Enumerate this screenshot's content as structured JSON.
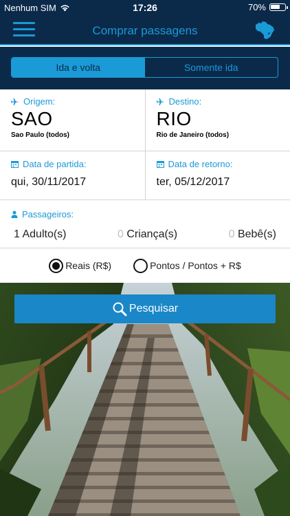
{
  "status": {
    "carrier": "Nenhum SIM",
    "time": "17:26",
    "battery_text": "70%",
    "battery_level": 0.7
  },
  "nav": {
    "title": "Comprar passagens",
    "menu_icon": "hamburger-menu-icon",
    "map_icon": "brazil-map-icon"
  },
  "trip_type": {
    "options": [
      "Ida e volta",
      "Somente ida"
    ],
    "selected": 0
  },
  "origin": {
    "label": "Origem:",
    "code": "SAO",
    "city": "Sao Paulo (todos)"
  },
  "destination": {
    "label": "Destino:",
    "code": "RIO",
    "city": "Rio de Janeiro (todos)"
  },
  "departure": {
    "label": "Data de partida:",
    "value": "qui, 30/11/2017"
  },
  "return": {
    "label": "Data de retorno:",
    "value": "ter, 05/12/2017"
  },
  "passengers": {
    "label": "Passageiros:",
    "adults": {
      "count": "1",
      "label": "Adulto(s)"
    },
    "children": {
      "count": "0",
      "label": "Criança(s)"
    },
    "infants": {
      "count": "0",
      "label": "Bebê(s)"
    }
  },
  "currency": {
    "options": [
      "Reais (R$)",
      "Pontos / Pontos + R$"
    ],
    "selected": 0
  },
  "search": {
    "label": "Pesquisar"
  },
  "colors": {
    "navy": "#0b2a4a",
    "accent": "#1a9ad6",
    "button": "#1a87c8"
  }
}
